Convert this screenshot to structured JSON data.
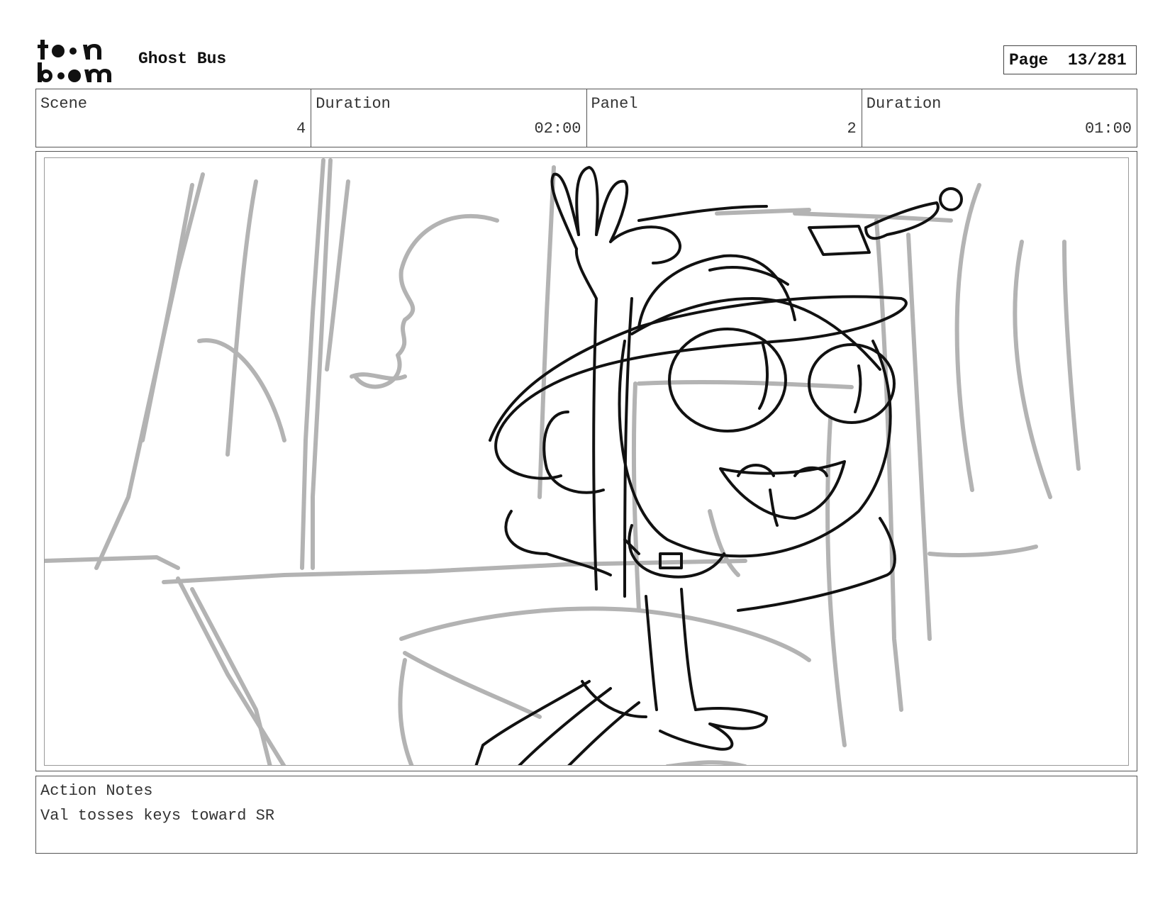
{
  "header": {
    "logo_text": "toon boom",
    "project_title": "Ghost Bus",
    "page_label": "Page",
    "page_value": "13/281"
  },
  "info": {
    "scene_label": "Scene",
    "scene_value": "4",
    "scene_duration_label": "Duration",
    "scene_duration_value": "02:00",
    "panel_label": "Panel",
    "panel_value": "2",
    "panel_duration_label": "Duration",
    "panel_duration_value": "01:00"
  },
  "notes": {
    "label": "Action Notes",
    "text": "Val tosses keys toward SR"
  },
  "colors": {
    "sketch_line": "#111111",
    "background_line": "#b3b3b3"
  }
}
